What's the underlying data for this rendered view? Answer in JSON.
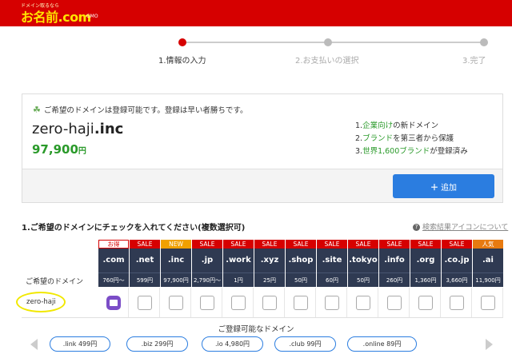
{
  "header": {
    "logo_tagline": "ドメイン取るなら",
    "logo_main": "お名前.com",
    "logo_sub": "GMO"
  },
  "steps": [
    {
      "label": "1.情報の入力",
      "active": true
    },
    {
      "label": "2.お支払いの選択",
      "active": false
    },
    {
      "label": "3.完了",
      "active": false
    }
  ],
  "result": {
    "message": "ご希望のドメインは登録可能です。登録は早い者勝ちです。",
    "domain_base": "zero-haji",
    "domain_tld": ".inc",
    "price_value": "97,900",
    "price_unit": "円",
    "features": [
      {
        "prefix": "1.",
        "green": "企業向け",
        "rest": "の新ドメイン"
      },
      {
        "prefix": "2.",
        "green": "ブランド",
        "rest": "を第三者から保護"
      },
      {
        "prefix": "3.",
        "green": "世界1,600ブランド",
        "rest": "が登録済み"
      }
    ],
    "add_label": "追加"
  },
  "section": {
    "title": "1.ご希望のドメインにチェックを入れてください(複数選択可)",
    "help_link": "検索結果アイコンについて"
  },
  "table": {
    "row_label": "ご希望のドメイン",
    "query": "zero-haji",
    "columns": [
      {
        "badge": "お得",
        "badge_type": "rec",
        "tld": ".com",
        "price": "760円〜",
        "state": "registered"
      },
      {
        "badge": "SALE",
        "badge_type": "sale",
        "tld": ".net",
        "price": "599円",
        "state": "unchecked"
      },
      {
        "badge": "NEW",
        "badge_type": "new",
        "tld": ".inc",
        "price": "97,900円",
        "state": "unchecked"
      },
      {
        "badge": "SALE",
        "badge_type": "sale",
        "tld": ".jp",
        "price": "2,790円〜",
        "state": "unchecked"
      },
      {
        "badge": "SALE",
        "badge_type": "sale",
        "tld": ".work",
        "price": "1円",
        "state": "unchecked"
      },
      {
        "badge": "SALE",
        "badge_type": "sale",
        "tld": ".xyz",
        "price": "25円",
        "state": "unchecked"
      },
      {
        "badge": "SALE",
        "badge_type": "sale",
        "tld": ".shop",
        "price": "50円",
        "state": "unchecked"
      },
      {
        "badge": "SALE",
        "badge_type": "sale",
        "tld": ".site",
        "price": "60円",
        "state": "unchecked"
      },
      {
        "badge": "SALE",
        "badge_type": "sale",
        "tld": ".tokyo",
        "price": "50円",
        "state": "unchecked"
      },
      {
        "badge": "SALE",
        "badge_type": "sale",
        "tld": ".info",
        "price": "260円",
        "state": "unchecked"
      },
      {
        "badge": "SALE",
        "badge_type": "sale",
        "tld": ".org",
        "price": "1,360円",
        "state": "unchecked"
      },
      {
        "badge": "SALE",
        "badge_type": "sale",
        "tld": ".co.jp",
        "price": "3,660円",
        "state": "unchecked"
      },
      {
        "badge": "人気",
        "badge_type": "pop",
        "tld": ".ai",
        "price": "11,900円",
        "state": "unchecked"
      }
    ]
  },
  "available": {
    "title": "ご登録可能なドメイン",
    "items": [
      ".link 499円",
      ".biz 299円",
      ".io 4,980円",
      ".club 99円",
      ".online 89円"
    ]
  },
  "colors": {
    "brand_red": "#d60000",
    "header_navy": "#2f3a52",
    "accent_blue": "#2b7de0",
    "price_green": "#2a9a2a"
  }
}
